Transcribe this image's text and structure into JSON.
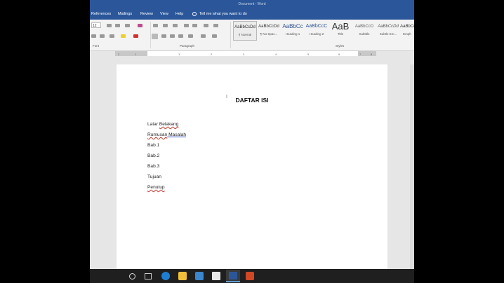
{
  "window": {
    "title": "Document - Word"
  },
  "menu": {
    "items": [
      "References",
      "Mailings",
      "Review",
      "View",
      "Help"
    ],
    "tell_me": "Tell me what you want to do"
  },
  "ribbon": {
    "font_size": "12",
    "groups": {
      "font": "Font",
      "paragraph": "Paragraph",
      "styles": "Styles"
    },
    "styles": [
      {
        "preview": "AaBbCcDd",
        "label": "¶ Normal"
      },
      {
        "preview": "AaBbCcDd",
        "label": "¶ No Spac..."
      },
      {
        "preview": "AaBbCc",
        "label": "Heading 1"
      },
      {
        "preview": "AaBbCcC",
        "label": "Heading 2"
      },
      {
        "preview": "AaB",
        "label": "Title"
      },
      {
        "preview": "AaBbCcD",
        "label": "Subtitle"
      },
      {
        "preview": "AaBbCcDd",
        "label": "Subtle Em..."
      },
      {
        "preview": "AaBbCcDd",
        "label": "Emph"
      }
    ]
  },
  "ruler": {
    "ticks": [
      "2",
      "1",
      "1",
      "2",
      "3",
      "4",
      "5",
      "6",
      "7",
      "8",
      "9"
    ]
  },
  "document": {
    "title": "DAFTAR ISI",
    "toc": [
      {
        "a": "Latar ",
        "b": "Belakang",
        "mark": "wavy"
      },
      {
        "a": "Rumusan",
        "b": " Masalah",
        "mark": "both"
      },
      {
        "a": "Bab.1",
        "b": "",
        "mark": "none"
      },
      {
        "a": "Bab.2",
        "b": "",
        "mark": "none"
      },
      {
        "a": "Bab.3",
        "b": "",
        "mark": "none"
      },
      {
        "a": "Tujuan",
        "b": "",
        "mark": "none"
      },
      {
        "a": "Penutup",
        "b": "",
        "mark": "wavy-all"
      }
    ]
  },
  "taskbar": {
    "icons": [
      "cortana-icon",
      "task-view-icon",
      "edge-icon",
      "file-explorer-icon",
      "store-icon",
      "mail-icon",
      "word-icon",
      "powerpoint-icon"
    ]
  },
  "colors": {
    "accent": "#2b579a",
    "spell_underline": "#c0392b",
    "grammar_underline": "#2b50b8"
  }
}
